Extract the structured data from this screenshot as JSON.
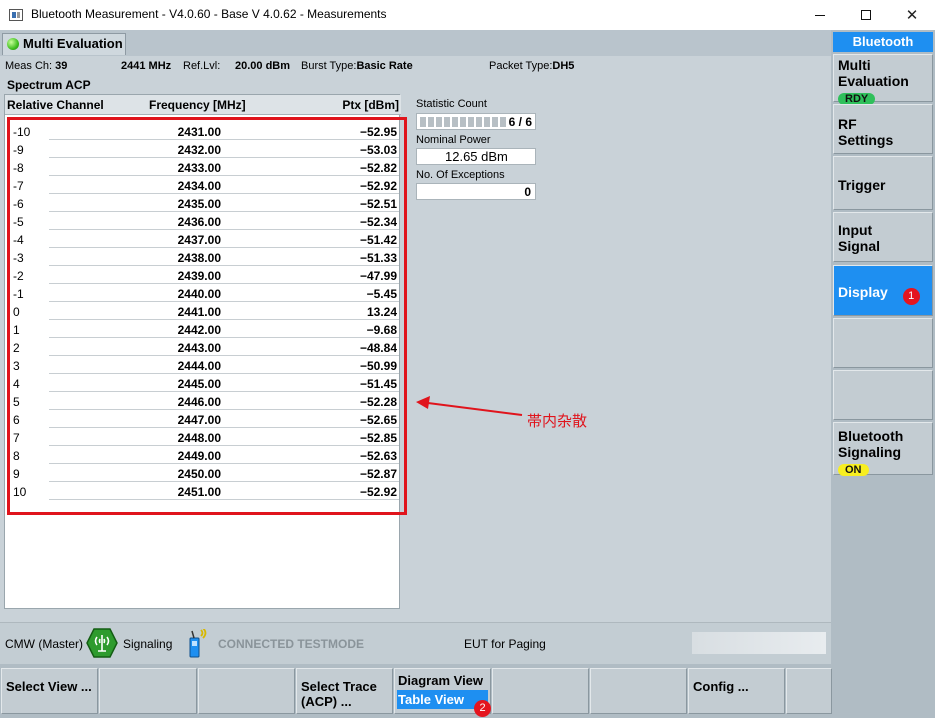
{
  "window": {
    "title": "Bluetooth Measurement  - V4.0.60 - Base V 4.0.62 - Measurements",
    "min_icon": "minimize-icon",
    "max_icon": "maximize-icon",
    "close_label": "✕"
  },
  "tab": {
    "label": "Multi Evaluation"
  },
  "info": {
    "meas_ch_label": "Meas Ch:",
    "meas_ch_value": "39",
    "freq_value": "2441 MHz",
    "ref_lvl_label": "Ref.Lvl:",
    "ref_lvl_value": "20.00 dBm",
    "burst_label": "Burst Type:",
    "burst_value": "Basic Rate",
    "packet_label": "Packet Type:",
    "packet_value": "DH5"
  },
  "section_title": "Spectrum ACP",
  "table": {
    "headers": {
      "channel": "Relative Channel",
      "frequency": "Frequency [MHz]",
      "ptx": "Ptx [dBm]"
    },
    "rows": [
      {
        "ch": "-10",
        "freq": "2431.00",
        "ptx": "−52.95"
      },
      {
        "ch": "-9",
        "freq": "2432.00",
        "ptx": "−53.03"
      },
      {
        "ch": "-8",
        "freq": "2433.00",
        "ptx": "−52.82"
      },
      {
        "ch": "-7",
        "freq": "2434.00",
        "ptx": "−52.92"
      },
      {
        "ch": "-6",
        "freq": "2435.00",
        "ptx": "−52.51"
      },
      {
        "ch": "-5",
        "freq": "2436.00",
        "ptx": "−52.34"
      },
      {
        "ch": "-4",
        "freq": "2437.00",
        "ptx": "−51.42"
      },
      {
        "ch": "-3",
        "freq": "2438.00",
        "ptx": "−51.33"
      },
      {
        "ch": "-2",
        "freq": "2439.00",
        "ptx": "−47.99"
      },
      {
        "ch": "-1",
        "freq": "2440.00",
        "ptx": "−5.45"
      },
      {
        "ch": "0",
        "freq": "2441.00",
        "ptx": "13.24"
      },
      {
        "ch": "1",
        "freq": "2442.00",
        "ptx": "−9.68"
      },
      {
        "ch": "2",
        "freq": "2443.00",
        "ptx": "−48.84"
      },
      {
        "ch": "3",
        "freq": "2444.00",
        "ptx": "−50.99"
      },
      {
        "ch": "4",
        "freq": "2445.00",
        "ptx": "−51.45"
      },
      {
        "ch": "5",
        "freq": "2446.00",
        "ptx": "−52.28"
      },
      {
        "ch": "6",
        "freq": "2447.00",
        "ptx": "−52.65"
      },
      {
        "ch": "7",
        "freq": "2448.00",
        "ptx": "−52.85"
      },
      {
        "ch": "8",
        "freq": "2449.00",
        "ptx": "−52.63"
      },
      {
        "ch": "9",
        "freq": "2450.00",
        "ptx": "−52.87"
      },
      {
        "ch": "10",
        "freq": "2451.00",
        "ptx": "−52.92"
      }
    ]
  },
  "stats": {
    "count_label": "Statistic Count",
    "count_value": "6 / 6",
    "count_progress": 1.0,
    "nominal_label": "Nominal Power",
    "nominal_value": "12.65  dBm",
    "exceptions_label": "No. Of Exceptions",
    "exceptions_value": "0"
  },
  "annotation": {
    "text": "帯内杂散",
    "color": "#e0141c"
  },
  "status": {
    "master": "CMW (Master)",
    "signaling": "Signaling",
    "connected": "CONNECTED TESTMODE",
    "eut": "EUT for Paging"
  },
  "softkeys": {
    "select_view": "Select View ...",
    "select_trace": "Select Trace (ACP) ...",
    "diagram_view": "Diagram View",
    "table_view": "Table View",
    "table_view_badge": "2",
    "config": "Config ..."
  },
  "sidebar": {
    "header": "Bluetooth",
    "multi_eval": "Multi Evaluation",
    "multi_eval_state": "RDY",
    "rf_settings": "RF Settings",
    "trigger": "Trigger",
    "input_signal": "Input Signal",
    "display": "Display",
    "display_badge": "1",
    "bt_signaling": "Bluetooth Signaling",
    "bt_signaling_state": "ON"
  },
  "colors": {
    "accent": "#1e8ff1",
    "highlight": "#e0141c",
    "ready": "#2fc05b",
    "on": "#f8ef20"
  }
}
